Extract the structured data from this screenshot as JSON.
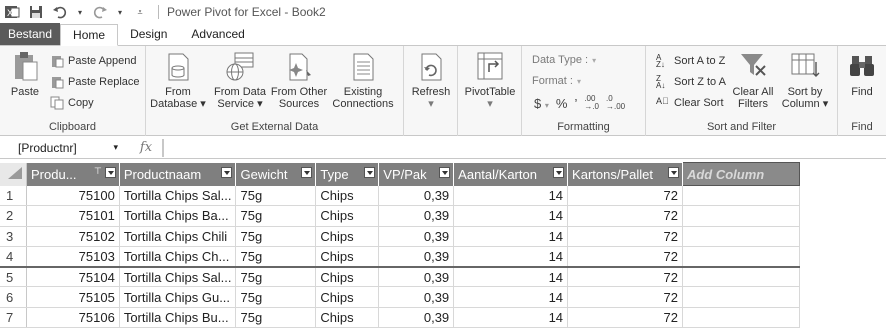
{
  "window": {
    "title": "Power Pivot for Excel - Book2"
  },
  "tabs": [
    {
      "label": "Bestand"
    },
    {
      "label": "Home"
    },
    {
      "label": "Design"
    },
    {
      "label": "Advanced"
    }
  ],
  "ribbon": {
    "clipboard": {
      "paste": "Paste",
      "paste_append": "Paste Append",
      "paste_replace": "Paste Replace",
      "copy": "Copy",
      "label": "Clipboard"
    },
    "external": {
      "from_database_1": "From",
      "from_database_2": "Database",
      "from_data_service_1": "From Data",
      "from_data_service_2": "Service",
      "from_other_1": "From Other",
      "from_other_2": "Sources",
      "existing_1": "Existing",
      "existing_2": "Connections",
      "label": "Get External Data"
    },
    "refresh": "Refresh",
    "pivottable": "PivotTable",
    "formatting": {
      "data_type": "Data Type :",
      "format": "Format :",
      "currency": "$",
      "percent": "%",
      "comma": "’",
      "inc": ".00 →.0",
      "dec": ".0 →.00",
      "label": "Formatting"
    },
    "sort": {
      "sort_az": "Sort A to Z",
      "sort_za": "Sort Z to A",
      "clear_sort": "Clear Sort",
      "clear_filters_1": "Clear All",
      "clear_filters_2": "Filters",
      "sort_by_col_1": "Sort by",
      "sort_by_col_2": "Column",
      "label": "Sort and Filter"
    },
    "find": {
      "button": "Find",
      "label": "Find"
    }
  },
  "formula_bar": {
    "name_box": "[Productnr]",
    "fx": "fx",
    "value": ""
  },
  "table": {
    "columns": [
      "Produ...",
      "Productnaam",
      "Gewicht",
      "Type",
      "VP/Pak",
      "Aantal/Karton",
      "Kartons/Pallet"
    ],
    "add_column": "Add Column",
    "rows": [
      {
        "n": "1",
        "cells": [
          "75100",
          "Tortilla Chips Sal...",
          "75g",
          "Chips",
          "0,39",
          "14",
          "72"
        ]
      },
      {
        "n": "2",
        "cells": [
          "75101",
          "Tortilla Chips Ba...",
          "75g",
          "Chips",
          "0,39",
          "14",
          "72"
        ]
      },
      {
        "n": "3",
        "cells": [
          "75102",
          "Tortilla Chips Chili",
          "75g",
          "Chips",
          "0,39",
          "14",
          "72"
        ]
      },
      {
        "n": "4",
        "cells": [
          "75103",
          "Tortilla Chips Ch...",
          "75g",
          "Chips",
          "0,39",
          "14",
          "72"
        ]
      },
      {
        "n": "5",
        "cells": [
          "75104",
          "Tortilla Chips Sal...",
          "75g",
          "Chips",
          "0,39",
          "14",
          "72"
        ]
      },
      {
        "n": "6",
        "cells": [
          "75105",
          "Tortilla Chips Gu...",
          "75g",
          "Chips",
          "0,39",
          "14",
          "72"
        ]
      },
      {
        "n": "7",
        "cells": [
          "75106",
          "Tortilla Chips Bu...",
          "75g",
          "Chips",
          "0,39",
          "14",
          "72"
        ]
      }
    ]
  }
}
